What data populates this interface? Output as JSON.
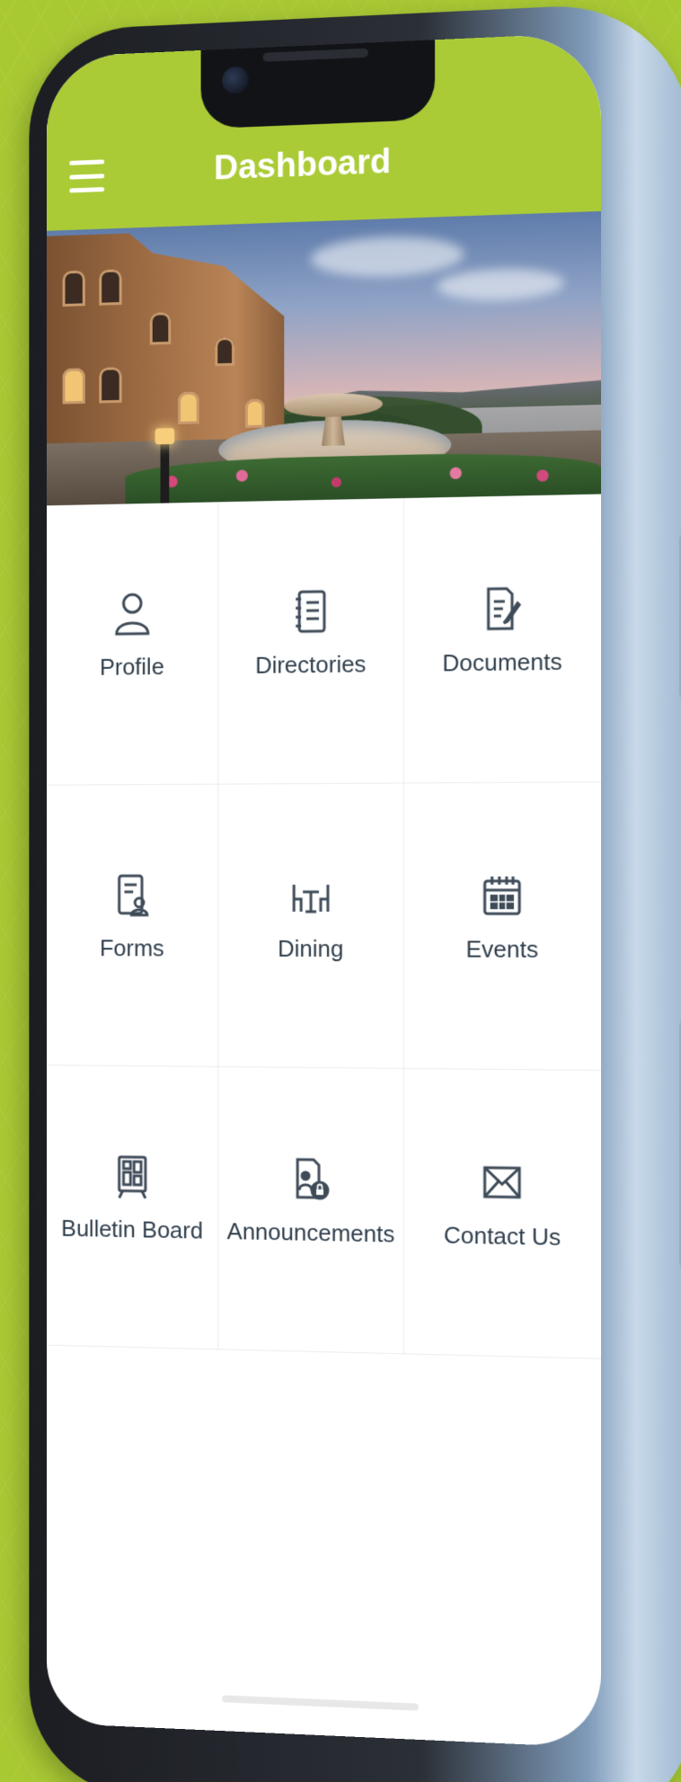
{
  "colors": {
    "brand_green": "#aacb36",
    "background_green": "#a9c933",
    "tile_text": "#2f3e4c",
    "icon_stroke": "#3e4b58"
  },
  "header": {
    "title": "Dashboard",
    "menu_icon": "hamburger-menu-icon"
  },
  "hero": {
    "icon": "resort-fountain-photo"
  },
  "tiles": [
    {
      "label": "Profile",
      "icon": "user-icon"
    },
    {
      "label": "Directories",
      "icon": "directory-book-icon"
    },
    {
      "label": "Documents",
      "icon": "document-edit-icon"
    },
    {
      "label": "Forms",
      "icon": "form-user-icon"
    },
    {
      "label": "Dining",
      "icon": "dining-table-icon"
    },
    {
      "label": "Events",
      "icon": "calendar-icon"
    },
    {
      "label": "Bulletin Board",
      "icon": "bulletin-board-icon"
    },
    {
      "label": "Announcements",
      "icon": "announcement-lock-icon"
    },
    {
      "label": "Contact Us",
      "icon": "envelope-icon"
    }
  ]
}
